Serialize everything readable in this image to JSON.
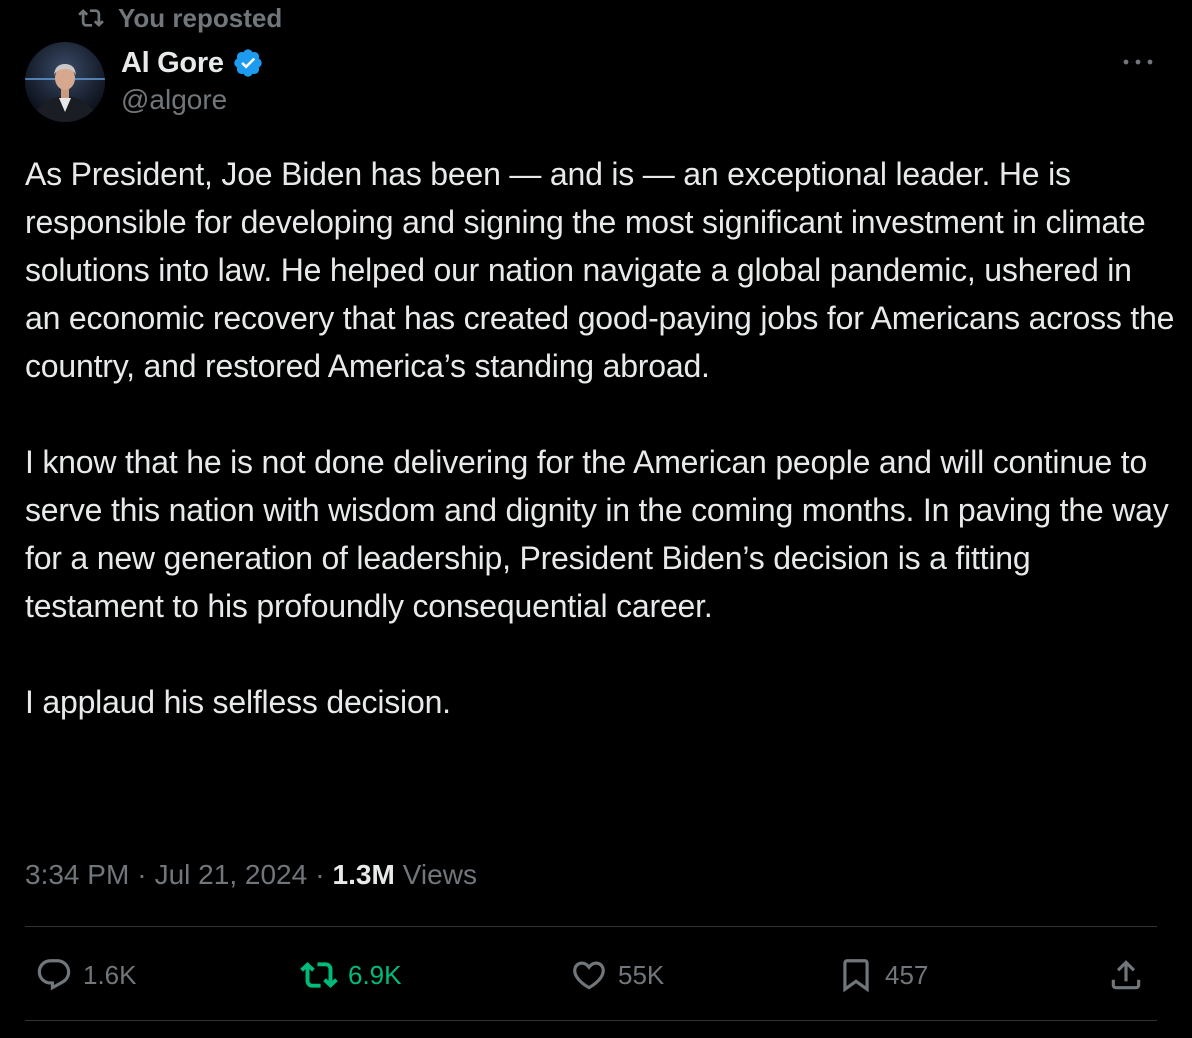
{
  "repost": {
    "label": "You reposted"
  },
  "author": {
    "name": "Al Gore",
    "handle": "@algore",
    "verified": true
  },
  "tweet": {
    "paragraphs": [
      "As President, Joe Biden has been — and is — an exceptional leader. He is responsible for developing and signing the most significant investment in climate solutions into law. He helped our nation navigate a global pandemic, ushered in an economic recovery that has created good-paying jobs for Americans across the country, and restored America’s standing abroad.",
      "I know that he is not done delivering for the American people and will continue to serve this nation with wisdom and dignity in the coming months. In paving the way for a new generation of leadership, President Biden’s decision is a fitting testament to his profoundly consequential career.",
      "I applaud his selfless decision."
    ],
    "time": "3:34 PM",
    "date": "Jul 21, 2024",
    "views_count": "1.3M",
    "views_label": "Views"
  },
  "actions": {
    "replies": "1.6K",
    "reposts": "6.9K",
    "likes": "55K",
    "bookmarks": "457"
  },
  "colors": {
    "background": "#000000",
    "text": "#e7e9ea",
    "muted": "#71767b",
    "repost_active": "#00ba7c",
    "verified": "#1d9bf0",
    "divider": "#2f3336"
  },
  "icons": {
    "repost": "repost-icon",
    "verified": "verified-badge-icon",
    "more": "more-dots-icon",
    "reply": "reply-icon",
    "like": "heart-icon",
    "bookmark": "bookmark-icon",
    "share": "share-icon"
  }
}
